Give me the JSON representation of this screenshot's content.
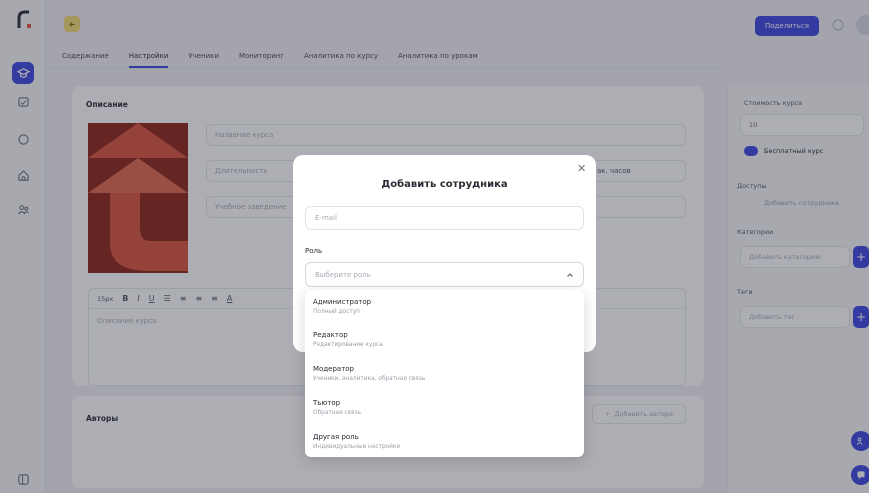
{
  "header": {
    "share_label": "Поделиться"
  },
  "tabs": [
    {
      "label": "Содержание"
    },
    {
      "label": "Настройки"
    },
    {
      "label": "Ученики"
    },
    {
      "label": "Мониторинг"
    },
    {
      "label": "Аналитика по курсу"
    },
    {
      "label": "Аналитика по урокам"
    }
  ],
  "description": {
    "title": "Описание",
    "course_name_placeholder": "Название курса",
    "duration_placeholder": "Длительность",
    "hours_unit": "ак. часов",
    "institution_placeholder": "Учебное заведение",
    "font_size": "15px",
    "editor_placeholder": "Описание курса"
  },
  "authors": {
    "title": "Авторы",
    "add_label": "Добавить автора"
  },
  "right_panel": {
    "price_label": "Стоимость курса",
    "price_value": "10",
    "free_label": "Бесплатный курс",
    "access_label": "Доступы",
    "add_staff_label": "Добавить сотрудника",
    "categories_label": "Категории",
    "categories_placeholder": "Добавить категорию",
    "tags_label": "Теги",
    "tags_placeholder": "Добавить тег"
  },
  "modal": {
    "title": "Добавить сотрудника",
    "email_placeholder": "E-mail",
    "role_label": "Роль",
    "role_placeholder": "Выберите роль",
    "options": [
      {
        "name": "Администратор",
        "desc": "Полный доступ"
      },
      {
        "name": "Редактор",
        "desc": "Редактирование курса"
      },
      {
        "name": "Модератор",
        "desc": "Ученики, аналитика, обратная связь"
      },
      {
        "name": "Тьютор",
        "desc": "Обратная связь"
      },
      {
        "name": "Другая роль",
        "desc": "Индивидуальные настройки"
      }
    ]
  },
  "colors": {
    "accent": "#3b46e0",
    "back_button": "#f2dc74",
    "cover": "#8b2418"
  },
  "icons": [
    "logo-icon",
    "graduation-cap-icon",
    "calendar-icon",
    "chat-bubble-icon",
    "home-icon",
    "users-icon",
    "sidebar-toggle-icon",
    "arrow-left-icon",
    "bell-icon",
    "close-icon",
    "chevron-up-icon",
    "plus-icon",
    "chat-icon"
  ]
}
